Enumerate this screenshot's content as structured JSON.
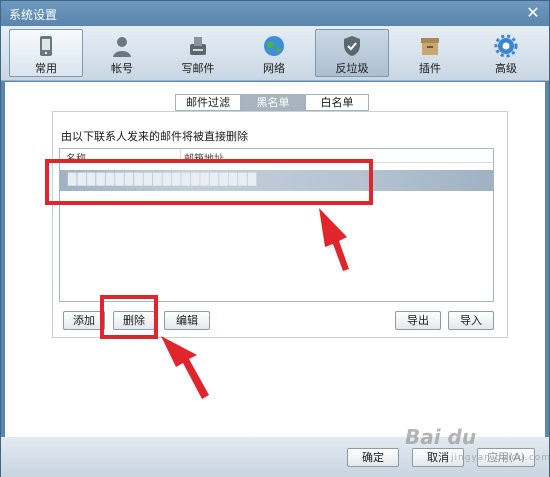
{
  "window": {
    "title": "系统设置"
  },
  "toolbar": {
    "items": [
      {
        "label": "常用",
        "icon": "phone-icon"
      },
      {
        "label": "帐号",
        "icon": "user-icon"
      },
      {
        "label": "写邮件",
        "icon": "compose-icon"
      },
      {
        "label": "网络",
        "icon": "globe-icon"
      },
      {
        "label": "反垃圾",
        "icon": "shield-icon"
      },
      {
        "label": "插件",
        "icon": "plugin-box-icon"
      },
      {
        "label": "高级",
        "icon": "gear-icon"
      }
    ]
  },
  "tabs": [
    {
      "label": "邮件过滤"
    },
    {
      "label": "黑名单"
    },
    {
      "label": "白名单"
    }
  ],
  "blacklist": {
    "hint": "由以下联系人发来的邮件将被直接删除",
    "columns": {
      "name": "名称",
      "address": "邮箱地址"
    },
    "rows": [
      {
        "text": "████████████████████"
      }
    ]
  },
  "buttons": {
    "add": "添加",
    "delete": "删除",
    "edit": "编辑",
    "export": "导出",
    "import": "导入"
  },
  "footer": {
    "ok": "确定",
    "cancel": "取消",
    "apply": "应用(A)"
  },
  "watermark": {
    "logo": "Bai du",
    "sub": "jingyan.baidu.com"
  },
  "colors": {
    "highlight": "#e0262c",
    "accent": "#5b87ae"
  }
}
